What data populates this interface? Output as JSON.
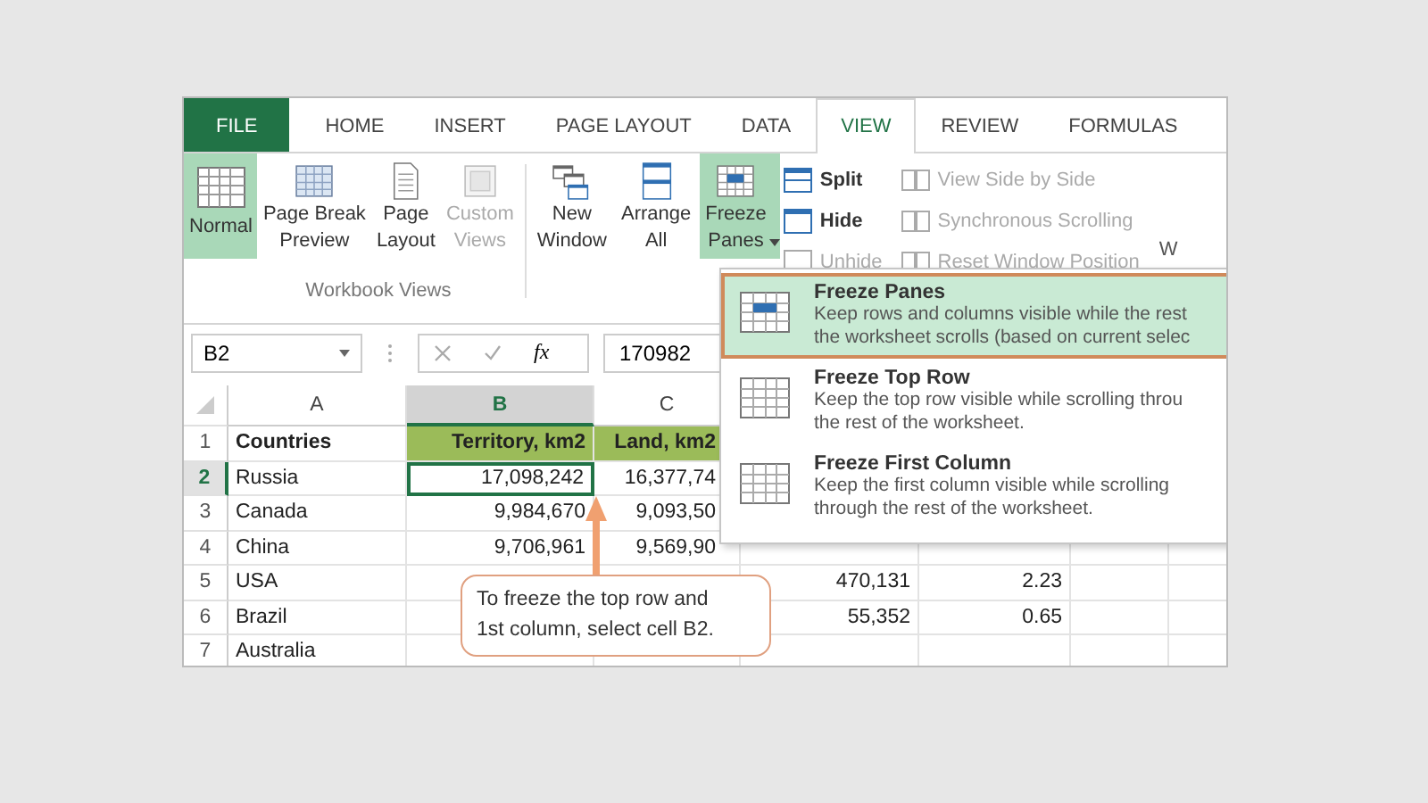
{
  "tabs": [
    {
      "label": "FILE",
      "kind": "file",
      "selected": false
    },
    {
      "label": "HOME",
      "kind": "tab",
      "selected": false
    },
    {
      "label": "INSERT",
      "kind": "tab",
      "selected": false
    },
    {
      "label": "PAGE LAYOUT",
      "kind": "tab",
      "selected": false
    },
    {
      "label": "DATA",
      "kind": "tab",
      "selected": false
    },
    {
      "label": "VIEW",
      "kind": "tab",
      "selected": true
    },
    {
      "label": "REVIEW",
      "kind": "tab",
      "selected": false
    },
    {
      "label": "FORMULAS",
      "kind": "tab",
      "selected": false
    }
  ],
  "ribbon": {
    "workbook_views": {
      "label": "Workbook Views",
      "buttons": [
        {
          "label": "Normal",
          "selected": true,
          "disabled": false
        },
        {
          "label": "Page Break\nPreview",
          "selected": false,
          "disabled": false
        },
        {
          "label": "Page\nLayout",
          "selected": false,
          "disabled": false
        },
        {
          "label": "Custom\nViews",
          "selected": false,
          "disabled": true
        }
      ]
    },
    "window": {
      "large_buttons": [
        {
          "label": "New\nWindow",
          "selected": false,
          "disabled": false,
          "dropdown": false
        },
        {
          "label": "Arrange\nAll",
          "selected": false,
          "disabled": false,
          "dropdown": false
        },
        {
          "label": "Freeze\nPanes",
          "selected": true,
          "disabled": false,
          "dropdown": true
        }
      ],
      "small_buttons": [
        {
          "label": "Split",
          "disabled": false
        },
        {
          "label": "Hide",
          "disabled": false
        },
        {
          "label": "Unhide",
          "disabled": true
        }
      ],
      "compare_buttons": [
        {
          "label": "View Side by Side",
          "disabled": true
        },
        {
          "label": "Synchronous Scrolling",
          "disabled": true
        },
        {
          "label": "Reset Window Position",
          "disabled": true
        }
      ],
      "cut_label": "W"
    }
  },
  "formula_bar": {
    "name_box": "B2",
    "function_label": "fx",
    "value": "170982"
  },
  "sheet": {
    "columns": [
      {
        "label": "A",
        "selected": false
      },
      {
        "label": "B",
        "selected": true
      },
      {
        "label": "C",
        "selected": false
      }
    ],
    "rows": [
      {
        "number": "1",
        "kind": "header",
        "selected": false,
        "cells": [
          "Countries",
          "Territory, km2",
          "Land, km2",
          null,
          null
        ]
      },
      {
        "number": "2",
        "kind": "data",
        "selected": true,
        "cells": [
          "Russia",
          "17,098,242",
          "16,377,74",
          null,
          null
        ]
      },
      {
        "number": "3",
        "kind": "data",
        "selected": false,
        "cells": [
          "Canada",
          "9,984,670",
          "9,093,50",
          null,
          null
        ]
      },
      {
        "number": "4",
        "kind": "data",
        "selected": false,
        "cells": [
          "China",
          "9,706,961",
          "9,569,90",
          null,
          null
        ]
      },
      {
        "number": "5",
        "kind": "data",
        "selected": false,
        "cells": [
          "USA",
          null,
          null,
          "470,131",
          "2.23"
        ]
      },
      {
        "number": "6",
        "kind": "data",
        "selected": false,
        "cells": [
          "Brazil",
          null,
          null,
          "55,352",
          "0.65"
        ]
      },
      {
        "number": "7",
        "kind": "data",
        "selected": false,
        "cells": [
          "Australia",
          null,
          null,
          null,
          null
        ]
      }
    ]
  },
  "freeze_menu": [
    {
      "title": "Freeze Panes",
      "description": "Keep rows and columns visible while the rest\nthe worksheet scrolls (based on current selec",
      "selected": true
    },
    {
      "title": "Freeze Top Row",
      "description": "Keep the top row visible while scrolling throu\nthe rest of the worksheet.",
      "selected": false
    },
    {
      "title": "Freeze First Column",
      "description": "Keep the first column visible while scrolling\nthrough the rest of the worksheet.",
      "selected": false
    }
  ],
  "callout": {
    "text": "To freeze the top row and\n1st column, select cell B2."
  }
}
